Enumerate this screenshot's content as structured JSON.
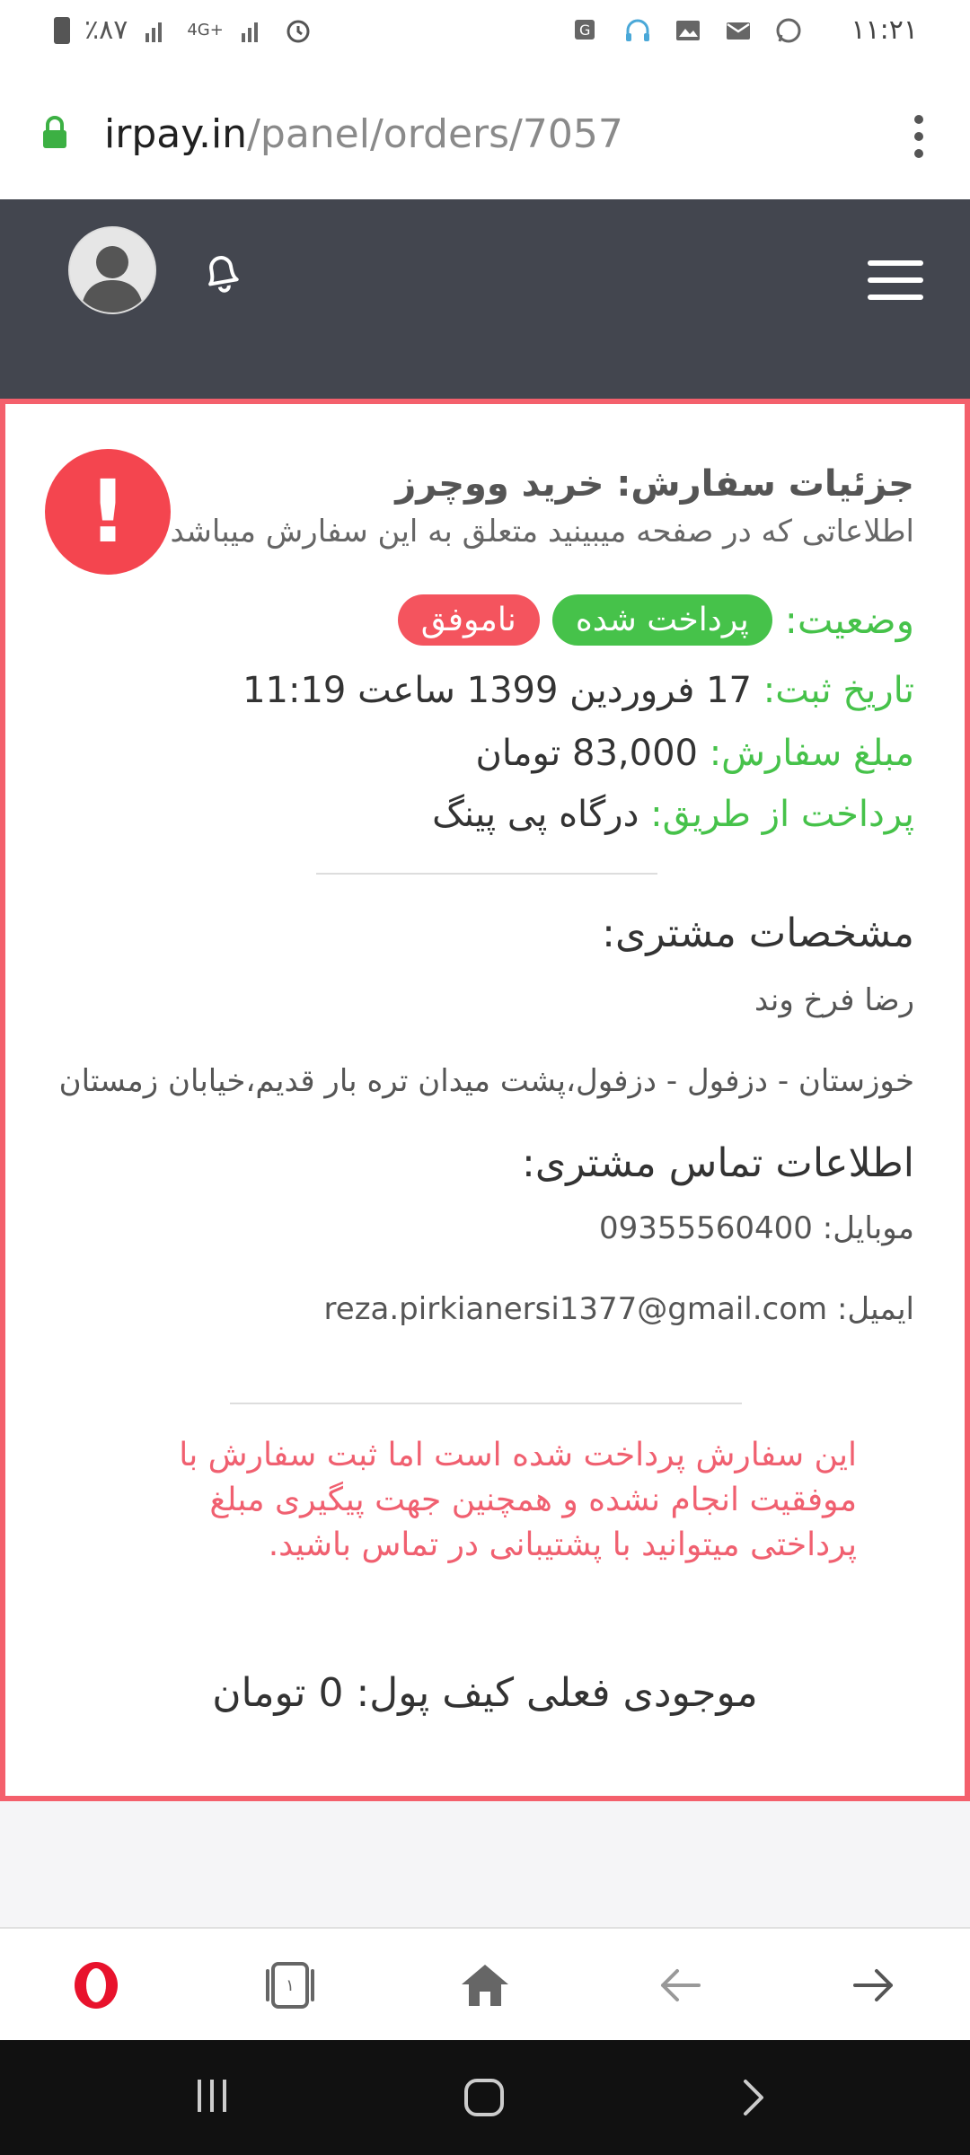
{
  "status_bar": {
    "battery_text": "٪۸۷",
    "network": "4G+",
    "time": "۱۱:۲۱"
  },
  "browser": {
    "url_host": "irpay.in",
    "url_path": "/panel/orders/7057"
  },
  "order": {
    "title": "جزئیات سفارش: خرید ووچرز",
    "subtitle": "اطلاعاتی که در صفحه میبینید متعلق به این سفارش میباشد",
    "alert_symbol": "!",
    "status_label": "وضعیت:",
    "status_paid": "پرداخت شده",
    "status_failed": "ناموفق",
    "date_label": "تاریخ ثبت:",
    "date_value": "17 فروردین 1399 ساعت 11:19",
    "amount_label": "مبلغ سفارش:",
    "amount_value": "83,000 تومان",
    "gateway_label": "پرداخت از طریق:",
    "gateway_value": "درگاه پی پینگ"
  },
  "customer": {
    "section_title": "مشخصات مشتری:",
    "name": "رضا فرخ وند",
    "address": "خوزستان - دزفول - دزفول،پشت میدان تره بار قدیم،خیابان زمستان",
    "contact_title": "اطلاعات تماس مشتری:",
    "mobile_label": "موبایل:",
    "mobile_value": "09355560400",
    "email_label": "ایمیل:",
    "email_value": "reza.pirkianersi1377@gmail.com"
  },
  "warning": "این سفارش پرداخت شده است اما ثبت سفارش با موفقیت انجام نشده و همچنین جهت پیگیری مبلغ پرداختی میتوانید با پشتیبانی در تماس باشید.",
  "wallet": {
    "label": "موجودی فعلی کیف پول:",
    "value": "0 تومان"
  },
  "bottom_nav": {
    "tabs_count": "۱"
  },
  "colors": {
    "accent_green": "#46c24a",
    "accent_red": "#f4545e",
    "header_bg": "#43464f"
  }
}
